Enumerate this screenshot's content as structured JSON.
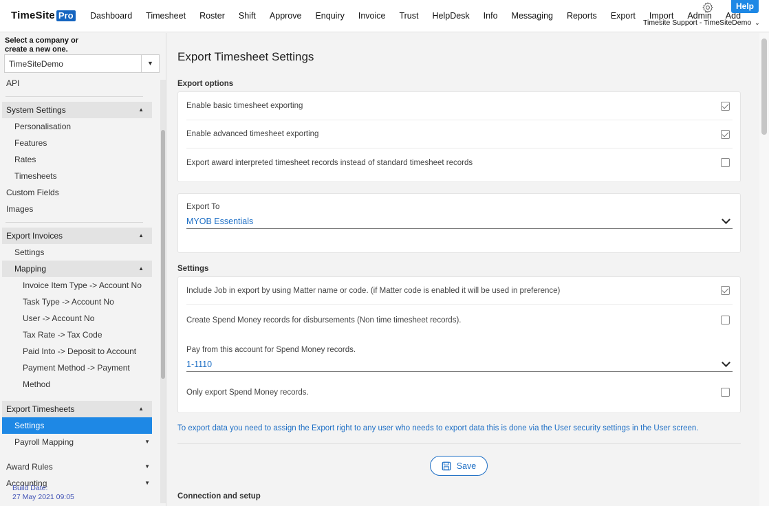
{
  "header": {
    "logo_text": "TimeSite",
    "logo_badge": "Pro",
    "nav": [
      "Dashboard",
      "Timesheet",
      "Roster",
      "Shift",
      "Approve",
      "Enquiry",
      "Invoice",
      "Trust",
      "HelpDesk",
      "Info",
      "Messaging",
      "Reports",
      "Export",
      "Import",
      "Admin",
      "Add"
    ],
    "help_label": "Help",
    "user_label": "Timesite Support - TimeSiteDemo"
  },
  "sidebar": {
    "company_prompt": "Select a company or create a new one.",
    "company_value": "TimeSiteDemo",
    "api": "API",
    "system_settings": "System Settings",
    "system_items": [
      "Personalisation",
      "Features",
      "Rates",
      "Timesheets"
    ],
    "custom_fields": "Custom Fields",
    "images": "Images",
    "export_invoices": "Export Invoices",
    "invoice_settings": "Settings",
    "mapping": "Mapping",
    "mapping_items": [
      "Invoice Item Type -> Account No",
      "Task Type -> Account No",
      "User -> Account No",
      "Tax Rate -> Tax Code",
      "Paid Into -> Deposit to Account",
      "Payment Method -> Payment",
      "Method"
    ],
    "export_timesheets": "Export Timesheets",
    "ts_settings": "Settings",
    "payroll_mapping": "Payroll Mapping",
    "award_rules": "Award Rules",
    "accounting": "Accounting",
    "build_label": "Build Date:",
    "build_date": "27 May 2021 09:05"
  },
  "main": {
    "title": "Export Timesheet Settings",
    "export_options_label": "Export options",
    "export_options": [
      {
        "label": "Enable basic timesheet exporting",
        "checked": true
      },
      {
        "label": "Enable advanced timesheet exporting",
        "checked": true
      },
      {
        "label": "Export award interpreted timesheet records instead of standard timesheet records",
        "checked": false
      }
    ],
    "export_to_label": "Export To",
    "export_to_value": "MYOB Essentials",
    "settings_label": "Settings",
    "settings_rows": [
      {
        "label": "Include Job in export by using Matter name or code. (if Matter code is enabled it will be used in preference)",
        "checked": true
      },
      {
        "label": "Create Spend Money records for disbursements (Non time timesheet records).",
        "checked": false
      }
    ],
    "pay_from_label": "Pay from this account for Spend Money records.",
    "pay_from_value": "1-1110",
    "only_export_label": "Only export Spend Money records.",
    "only_export_checked": false,
    "info_text": "To export data you need to assign the Export right to any user who needs to export data this is done via the User security settings in the User screen.",
    "save_label": "Save",
    "connection_label": "Connection and setup"
  }
}
